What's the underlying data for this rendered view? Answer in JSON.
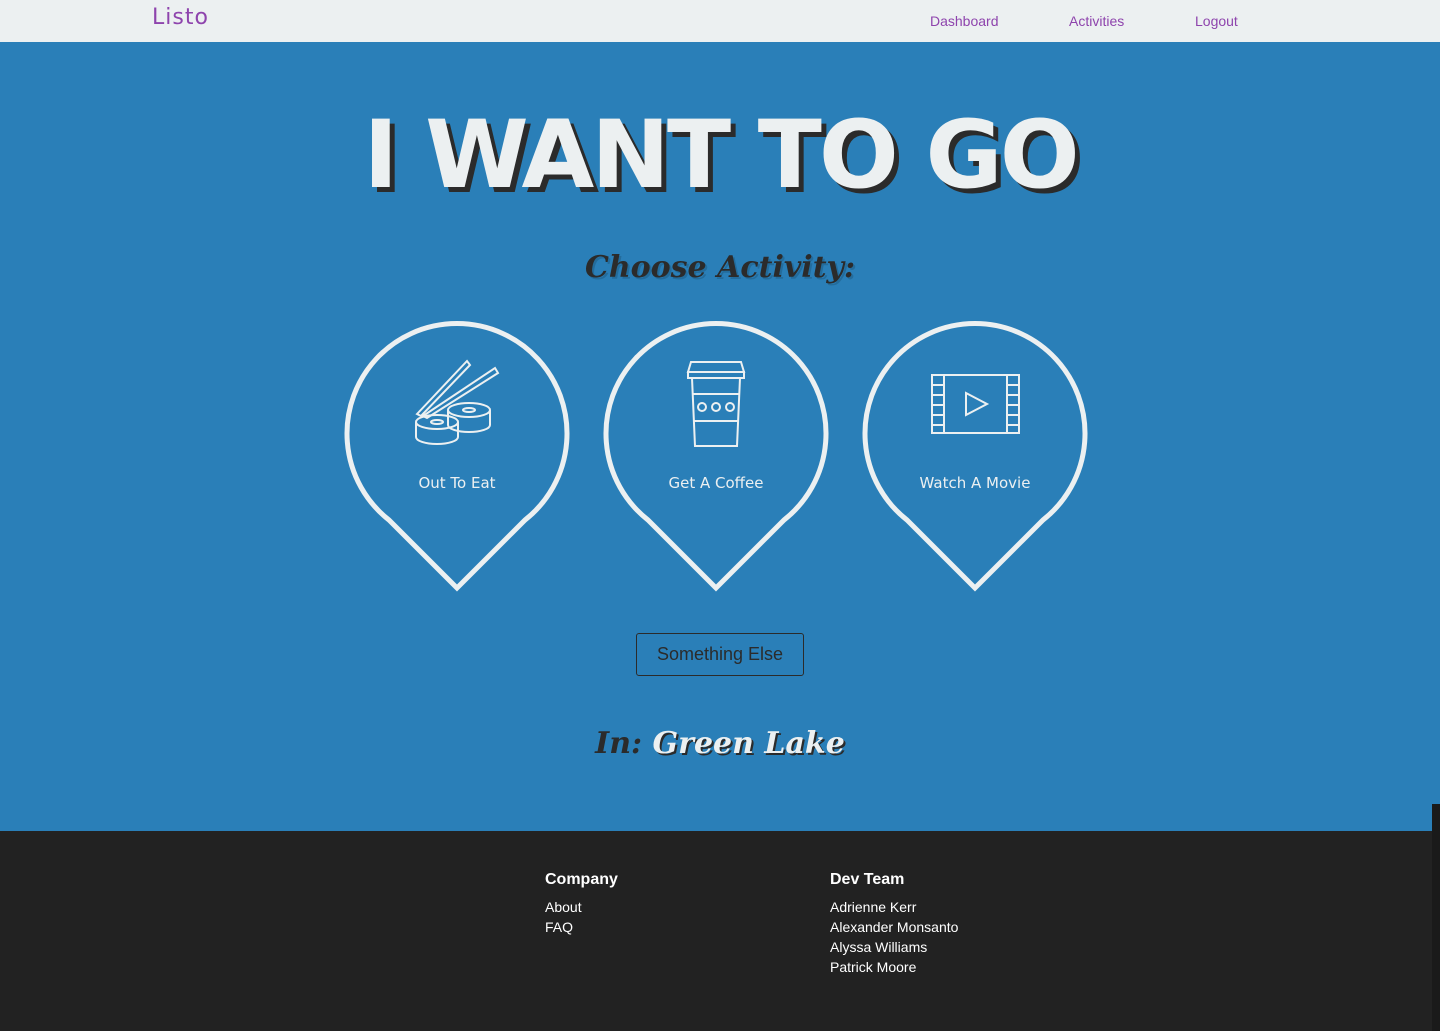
{
  "navbar": {
    "logo": "Listo",
    "links": [
      "Dashboard",
      "Activities",
      "Logout"
    ]
  },
  "hero": {
    "title": "I WANT TO GO",
    "choose_label": "Choose Activity:",
    "activities": [
      {
        "label": "Out To Eat",
        "icon": "sushi-icon"
      },
      {
        "label": "Get A Coffee",
        "icon": "coffee-cup-icon"
      },
      {
        "label": "Watch A Movie",
        "icon": "film-icon"
      }
    ],
    "something_else_button": "Something Else",
    "location_prefix": "In:",
    "location_place": "Green Lake"
  },
  "footer": {
    "company": {
      "heading": "Company",
      "items": [
        "About",
        "FAQ"
      ]
    },
    "dev_team": {
      "heading": "Dev Team",
      "items": [
        "Adrienne Kerr",
        "Alexander Monsanto",
        "Alyssa Williams",
        "Patrick Moore"
      ]
    }
  },
  "colors": {
    "brand": "#8e44ad",
    "hero_bg": "#2a7fb8",
    "light": "#ecf0f1",
    "dark": "#2b2b2b",
    "footer_bg": "#222222"
  }
}
